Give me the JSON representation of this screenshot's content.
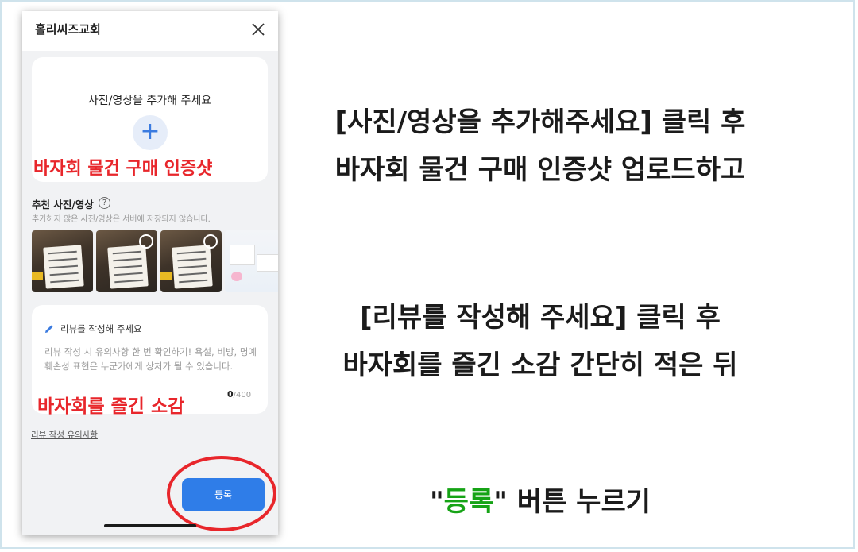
{
  "phone": {
    "title": "홀리씨즈교회",
    "upload_prompt": "사진/영상을 추가해 주세요",
    "overlay_upload": "바자회 물건 구매 인증샷",
    "recommended_title": "추천 사진/영상",
    "recommended_note": "추가하지 않은 사진/영상은 서버에 저장되지 않습니다.",
    "review_title": "리뷰를 작성해 주세요",
    "review_guide": "리뷰 작성 시 유의사항 한 번 확인하기! 욕설, 비방, 명예훼손성 표현은 누군가에게 상처가 될 수 있습니다.",
    "overlay_review": "바자회를 즐긴 소감",
    "count_current": "0",
    "count_max": "/400",
    "guide_link": "리뷰 작성 유의사항",
    "submit_label": "등록"
  },
  "instructions": {
    "line1": "[사진/영상을 추가해주세요] 클릭 후",
    "line2": "바자회 물건 구매 인증샷 업로드하고",
    "line3": "[리뷰를 작성해 주세요] 클릭 후",
    "line4": "바자회를 즐긴 소감 간단히 적은 뒤",
    "line5_open": "\"",
    "line5_button": "등록",
    "line5_rest": "\" 버튼 누르기"
  },
  "colors": {
    "accent_blue": "#2f7de8",
    "highlight_red": "#e8262b",
    "highlight_green": "#16a316"
  },
  "icons": [
    "close-icon",
    "plus-icon",
    "help-icon",
    "pencil-icon"
  ]
}
